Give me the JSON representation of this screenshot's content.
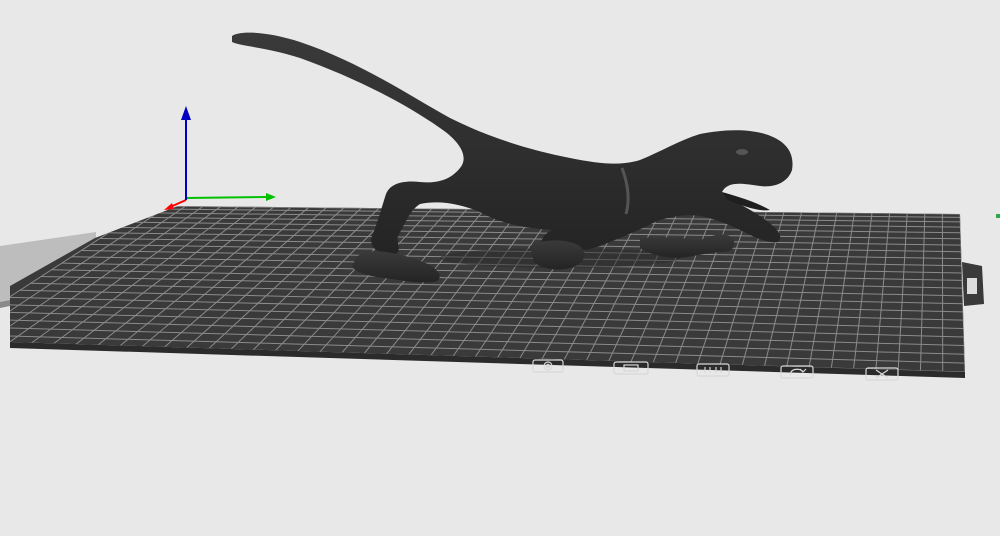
{
  "viewport": {
    "background": "#e8e8e8",
    "bed_color": "#3a3a3a",
    "grid_color": "#9a9a9a",
    "model_color": "#2e2e2e"
  },
  "axes": {
    "x_color": "#00c000",
    "y_color": "#ff0000",
    "z_color": "#0000c0"
  },
  "model": {
    "icon": "dinosaur-raptor-model"
  },
  "bed_front_icons": [
    {
      "name": "bed-icon-circle"
    },
    {
      "name": "bed-icon-rect"
    },
    {
      "name": "bed-icon-bars"
    },
    {
      "name": "bed-icon-rotate"
    },
    {
      "name": "bed-icon-x"
    }
  ]
}
